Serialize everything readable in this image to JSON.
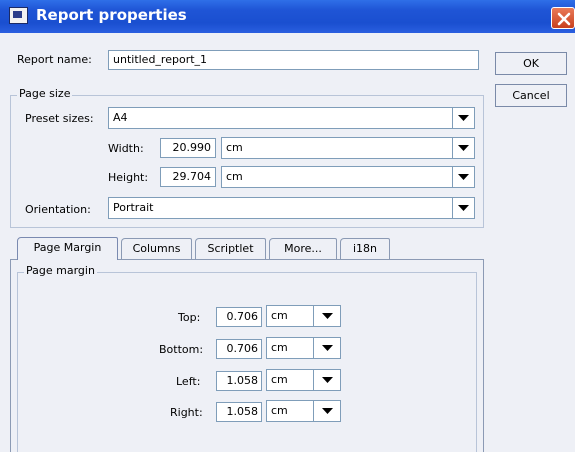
{
  "window": {
    "title": "Report properties"
  },
  "report_name": {
    "label": "Report name:",
    "value": "untitled_report_1"
  },
  "buttons": {
    "ok": "OK",
    "cancel": "Cancel"
  },
  "page_size": {
    "group_title": "Page size",
    "preset_label": "Preset sizes:",
    "preset_value": "A4",
    "width_label": "Width:",
    "width_value": "20.990",
    "width_unit": "cm",
    "height_label": "Height:",
    "height_value": "29.704",
    "height_unit": "cm",
    "orientation_label": "Orientation:",
    "orientation_value": "Portrait"
  },
  "tabs": [
    {
      "label": "Page Margin",
      "active": true
    },
    {
      "label": "Columns",
      "active": false
    },
    {
      "label": "Scriptlet",
      "active": false
    },
    {
      "label": "More...",
      "active": false
    },
    {
      "label": "i18n",
      "active": false
    }
  ],
  "page_margin": {
    "group_title": "Page margin",
    "top_label": "Top:",
    "top_value": "0.706",
    "top_unit": "cm",
    "bottom_label": "Bottom:",
    "bottom_value": "0.706",
    "bottom_unit": "cm",
    "left_label": "Left:",
    "left_value": "1.058",
    "left_unit": "cm",
    "right_label": "Right:",
    "right_value": "1.058",
    "right_unit": "cm"
  },
  "icons": {
    "title": "report-window-icon",
    "close": "close-icon",
    "dropdown": "dropdown-arrow-icon"
  },
  "colors": {
    "titlebar": "#1f55d6",
    "close_button": "#d4522e",
    "field_border": "#7f9db9",
    "window_bg": "#eef0f6"
  }
}
